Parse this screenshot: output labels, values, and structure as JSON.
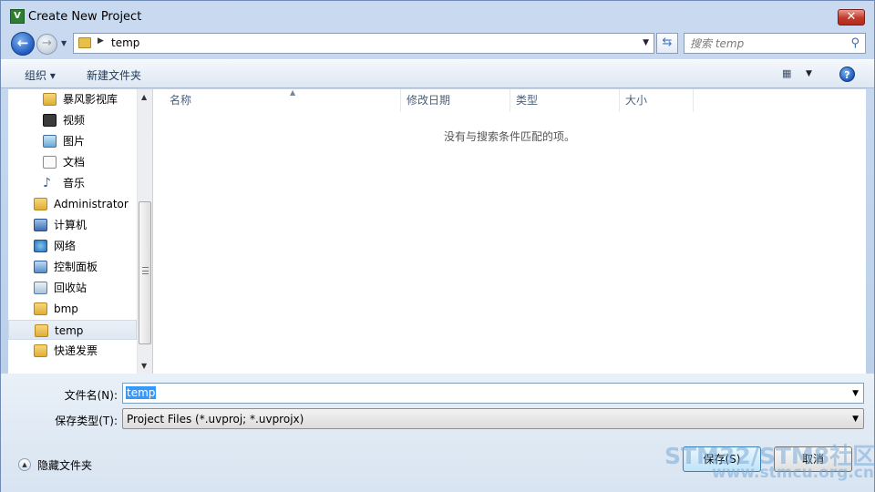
{
  "window": {
    "title": "Create New Project"
  },
  "address": {
    "folder": "temp"
  },
  "search": {
    "placeholder": "搜索 temp"
  },
  "toolbar": {
    "organize": "组织 ▾",
    "new_folder": "新建文件夹"
  },
  "nav_items": [
    {
      "label": "暴风影视库",
      "icon": "folder"
    },
    {
      "label": "视频",
      "icon": "video"
    },
    {
      "label": "图片",
      "icon": "picture"
    },
    {
      "label": "文档",
      "icon": "document"
    },
    {
      "label": "音乐",
      "icon": "music"
    },
    {
      "label": "Administrator",
      "icon": "user-folder"
    },
    {
      "label": "计算机",
      "icon": "computer"
    },
    {
      "label": "网络",
      "icon": "network"
    },
    {
      "label": "控制面板",
      "icon": "control-panel"
    },
    {
      "label": "回收站",
      "icon": "recycle-bin"
    },
    {
      "label": "bmp",
      "icon": "folder"
    },
    {
      "label": "temp",
      "icon": "folder",
      "selected": true
    },
    {
      "label": "快递发票",
      "icon": "folder"
    }
  ],
  "columns": {
    "name": "名称",
    "date": "修改日期",
    "type": "类型",
    "size": "大小"
  },
  "empty_message": "没有与搜索条件匹配的项。",
  "form": {
    "file_name_label": "文件名(N):",
    "file_name_value": "temp",
    "file_type_label": "保存类型(T):",
    "file_type_value": "Project Files (*.uvproj; *.uvprojx)"
  },
  "footer": {
    "hide_folders": "隐藏文件夹",
    "save": "保存(S)",
    "cancel": "取消"
  },
  "watermark": {
    "line1": "STM32/STM8社区",
    "line2": "www.stmcu.org.cn"
  }
}
